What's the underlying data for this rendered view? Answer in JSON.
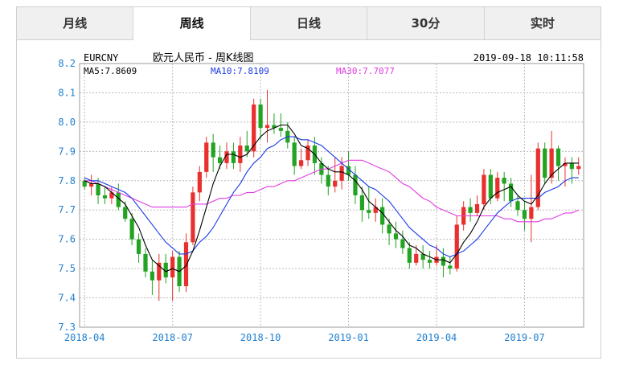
{
  "tabs": [
    {
      "label": "月线",
      "active": false
    },
    {
      "label": "周线",
      "active": true
    },
    {
      "label": "日线",
      "active": false
    },
    {
      "label": "30分",
      "active": false
    },
    {
      "label": "实时",
      "active": false
    }
  ],
  "header": {
    "symbol": "EURCNY",
    "title": "欧元人民币 - 周K线图",
    "datetime": "2019-09-18 10:11:58"
  },
  "ma": {
    "ma5": {
      "label": "MA5:7.8609",
      "color": "#000000"
    },
    "ma10": {
      "label": "MA10:7.8109",
      "color": "#1a3ae6"
    },
    "ma30": {
      "label": "MA30:7.7077",
      "color": "#e23ae2"
    }
  },
  "colors": {
    "up": "#e8302e",
    "down": "#22a322",
    "axis": "#1e7fd0",
    "grid": "#bbbbbb"
  },
  "chart_data": {
    "type": "candlestick",
    "ylim": [
      7.3,
      8.2
    ],
    "yticks": [
      "8.2",
      "8.1",
      "8.0",
      "7.9",
      "7.8",
      "7.7",
      "7.6",
      "7.5",
      "7.4",
      "7.3"
    ],
    "xticks": [
      {
        "label": "2018-04",
        "index": 0
      },
      {
        "label": "2018-07",
        "index": 13
      },
      {
        "label": "2018-10",
        "index": 26
      },
      {
        "label": "2019-01",
        "index": 39
      },
      {
        "label": "2019-04",
        "index": 52
      },
      {
        "label": "2019-07",
        "index": 65
      }
    ],
    "candles": [
      [
        7.8,
        7.78,
        7.81,
        7.77
      ],
      [
        7.78,
        7.79,
        7.82,
        7.75
      ],
      [
        7.79,
        7.75,
        7.81,
        7.72
      ],
      [
        7.75,
        7.74,
        7.78,
        7.72
      ],
      [
        7.74,
        7.76,
        7.78,
        7.72
      ],
      [
        7.76,
        7.71,
        7.79,
        7.7
      ],
      [
        7.71,
        7.67,
        7.73,
        7.66
      ],
      [
        7.67,
        7.6,
        7.69,
        7.58
      ],
      [
        7.6,
        7.55,
        7.62,
        7.52
      ],
      [
        7.55,
        7.49,
        7.57,
        7.47
      ],
      [
        7.49,
        7.46,
        7.53,
        7.41
      ],
      [
        7.46,
        7.52,
        7.55,
        7.39
      ],
      [
        7.52,
        7.47,
        7.55,
        7.45
      ],
      [
        7.47,
        7.54,
        7.56,
        7.39
      ],
      [
        7.54,
        7.44,
        7.56,
        7.42
      ],
      [
        7.44,
        7.59,
        7.62,
        7.42
      ],
      [
        7.59,
        7.76,
        7.78,
        7.58
      ],
      [
        7.76,
        7.83,
        7.85,
        7.73
      ],
      [
        7.83,
        7.93,
        7.95,
        7.81
      ],
      [
        7.93,
        7.88,
        7.96,
        7.83
      ],
      [
        7.88,
        7.86,
        7.92,
        7.84
      ],
      [
        7.86,
        7.9,
        7.93,
        7.84
      ],
      [
        7.9,
        7.86,
        7.93,
        7.84
      ],
      [
        7.86,
        7.92,
        7.95,
        7.83
      ],
      [
        7.92,
        7.9,
        7.97,
        7.88
      ],
      [
        7.9,
        8.06,
        8.08,
        7.88
      ],
      [
        8.06,
        7.98,
        8.08,
        7.94
      ],
      [
        7.98,
        7.99,
        8.11,
        7.93
      ],
      [
        7.99,
        7.98,
        8.03,
        7.96
      ],
      [
        7.98,
        7.97,
        8.03,
        7.95
      ],
      [
        7.97,
        7.93,
        8.0,
        7.91
      ],
      [
        7.93,
        7.85,
        7.95,
        7.82
      ],
      [
        7.85,
        7.87,
        7.91,
        7.84
      ],
      [
        7.87,
        7.92,
        7.94,
        7.85
      ],
      [
        7.92,
        7.86,
        7.95,
        7.82
      ],
      [
        7.86,
        7.82,
        7.88,
        7.79
      ],
      [
        7.82,
        7.78,
        7.85,
        7.75
      ],
      [
        7.78,
        7.8,
        7.88,
        7.76
      ],
      [
        7.8,
        7.85,
        7.88,
        7.77
      ],
      [
        7.85,
        7.82,
        7.9,
        7.8
      ],
      [
        7.82,
        7.75,
        7.85,
        7.72
      ],
      [
        7.75,
        7.7,
        7.78,
        7.66
      ],
      [
        7.7,
        7.69,
        7.78,
        7.67
      ],
      [
        7.69,
        7.71,
        7.74,
        7.66
      ],
      [
        7.71,
        7.65,
        7.74,
        7.62
      ],
      [
        7.65,
        7.62,
        7.67,
        7.58
      ],
      [
        7.62,
        7.6,
        7.66,
        7.57
      ],
      [
        7.6,
        7.57,
        7.63,
        7.55
      ],
      [
        7.57,
        7.52,
        7.59,
        7.5
      ],
      [
        7.52,
        7.55,
        7.58,
        7.51
      ],
      [
        7.55,
        7.53,
        7.58,
        7.5
      ],
      [
        7.53,
        7.52,
        7.56,
        7.5
      ],
      [
        7.52,
        7.54,
        7.58,
        7.51
      ],
      [
        7.54,
        7.51,
        7.57,
        7.47
      ],
      [
        7.51,
        7.5,
        7.54,
        7.48
      ],
      [
        7.5,
        7.65,
        7.68,
        7.49
      ],
      [
        7.65,
        7.71,
        7.73,
        7.63
      ],
      [
        7.71,
        7.69,
        7.74,
        7.66
      ],
      [
        7.69,
        7.72,
        7.75,
        7.68
      ],
      [
        7.72,
        7.82,
        7.84,
        7.7
      ],
      [
        7.82,
        7.74,
        7.84,
        7.72
      ],
      [
        7.74,
        7.81,
        7.83,
        7.73
      ],
      [
        7.81,
        7.79,
        7.83,
        7.73
      ],
      [
        7.79,
        7.73,
        7.81,
        7.71
      ],
      [
        7.73,
        7.7,
        7.75,
        7.68
      ],
      [
        7.7,
        7.67,
        7.73,
        7.63
      ],
      [
        7.67,
        7.71,
        7.82,
        7.59
      ],
      [
        7.71,
        7.91,
        7.93,
        7.7
      ],
      [
        7.91,
        7.81,
        7.93,
        7.79
      ],
      [
        7.81,
        7.91,
        7.97,
        7.79
      ],
      [
        7.91,
        7.85,
        7.92,
        7.8
      ],
      [
        7.85,
        7.86,
        7.88,
        7.78
      ],
      [
        7.86,
        7.84,
        7.88,
        7.79
      ],
      [
        7.84,
        7.85,
        7.88,
        7.82
      ]
    ],
    "ma5": [
      7.8,
      7.79,
      7.79,
      7.78,
      7.76,
      7.74,
      7.72,
      7.68,
      7.64,
      7.58,
      7.53,
      7.51,
      7.49,
      7.5,
      7.49,
      7.51,
      7.56,
      7.63,
      7.71,
      7.79,
      7.85,
      7.89,
      7.89,
      7.88,
      7.89,
      7.92,
      7.95,
      7.97,
      7.98,
      7.99,
      7.99,
      7.96,
      7.92,
      7.91,
      7.89,
      7.86,
      7.84,
      7.83,
      7.83,
      7.82,
      7.8,
      7.77,
      7.73,
      7.71,
      7.69,
      7.66,
      7.63,
      7.61,
      7.58,
      7.57,
      7.55,
      7.54,
      7.53,
      7.53,
      7.52,
      7.55,
      7.59,
      7.62,
      7.66,
      7.71,
      7.74,
      7.76,
      7.77,
      7.78,
      7.75,
      7.73,
      7.72,
      7.75,
      7.79,
      7.82,
      7.84,
      7.86,
      7.86,
      7.86
    ],
    "ma10": [
      7.81,
      7.8,
      7.8,
      7.79,
      7.78,
      7.77,
      7.76,
      7.74,
      7.71,
      7.68,
      7.65,
      7.62,
      7.59,
      7.57,
      7.55,
      7.55,
      7.56,
      7.59,
      7.61,
      7.64,
      7.68,
      7.72,
      7.76,
      7.79,
      7.83,
      7.86,
      7.88,
      7.91,
      7.92,
      7.94,
      7.95,
      7.95,
      7.94,
      7.94,
      7.93,
      7.92,
      7.9,
      7.88,
      7.86,
      7.84,
      7.82,
      7.8,
      7.78,
      7.77,
      7.75,
      7.73,
      7.7,
      7.67,
      7.64,
      7.62,
      7.6,
      7.58,
      7.57,
      7.55,
      7.54,
      7.55,
      7.56,
      7.58,
      7.6,
      7.63,
      7.66,
      7.69,
      7.71,
      7.73,
      7.74,
      7.74,
      7.74,
      7.74,
      7.76,
      7.77,
      7.78,
      7.8,
      7.81,
      7.81
    ],
    "ma30": [
      7.8,
      7.8,
      7.79,
      7.78,
      7.77,
      7.76,
      7.75,
      7.74,
      7.73,
      7.72,
      7.71,
      7.71,
      7.71,
      7.71,
      7.71,
      7.71,
      7.72,
      7.72,
      7.72,
      7.73,
      7.74,
      7.74,
      7.75,
      7.75,
      7.76,
      7.76,
      7.77,
      7.78,
      7.78,
      7.79,
      7.8,
      7.8,
      7.81,
      7.82,
      7.83,
      7.84,
      7.84,
      7.85,
      7.86,
      7.87,
      7.87,
      7.87,
      7.86,
      7.85,
      7.84,
      7.83,
      7.81,
      7.79,
      7.78,
      7.76,
      7.74,
      7.73,
      7.71,
      7.7,
      7.69,
      7.68,
      7.68,
      7.68,
      7.68,
      7.68,
      7.68,
      7.68,
      7.67,
      7.67,
      7.66,
      7.66,
      7.66,
      7.66,
      7.67,
      7.67,
      7.68,
      7.69,
      7.69,
      7.7
    ]
  }
}
